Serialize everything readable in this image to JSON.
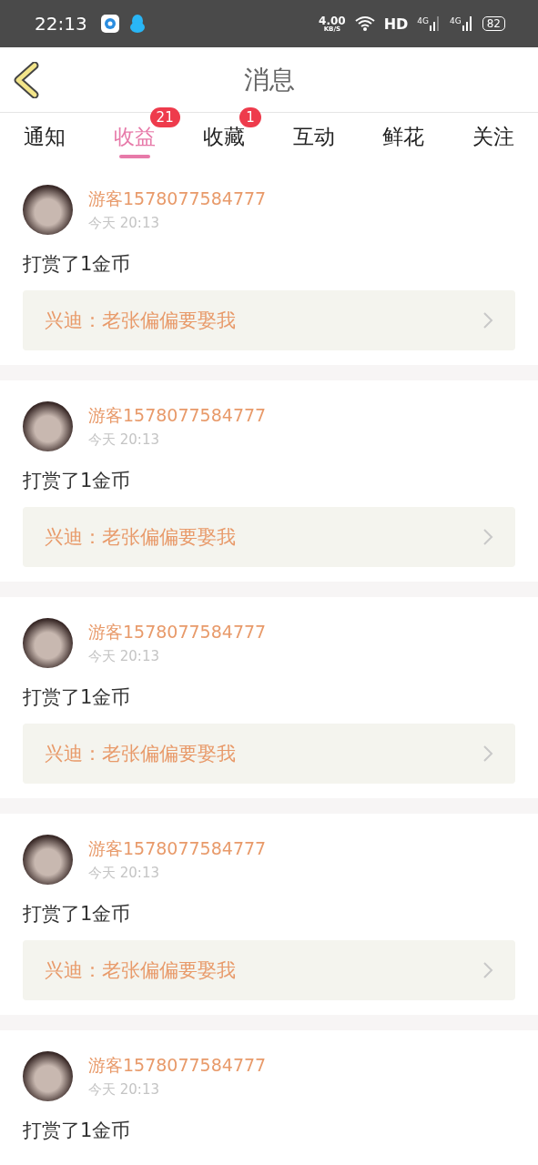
{
  "status_bar": {
    "time": "22:13",
    "speed_value": "4.00",
    "speed_unit": "KB/S",
    "hd": "HD",
    "network_1": "4G",
    "network_2": "4G",
    "battery": "82"
  },
  "header": {
    "title": "消息"
  },
  "tabs": [
    {
      "label": "通知",
      "selected": false
    },
    {
      "label": "收益",
      "selected": true,
      "badge": "21"
    },
    {
      "label": "收藏",
      "selected": false,
      "badge": "1"
    },
    {
      "label": "互动",
      "selected": false
    },
    {
      "label": "鲜花",
      "selected": false
    },
    {
      "label": "关注",
      "selected": false
    }
  ],
  "messages": [
    {
      "user": "游客1578077584777",
      "time": "今天 20:13",
      "text": "打赏了1金币",
      "link": "兴迪：老张偏偏要娶我"
    },
    {
      "user": "游客1578077584777",
      "time": "今天 20:13",
      "text": "打赏了1金币",
      "link": "兴迪：老张偏偏要娶我"
    },
    {
      "user": "游客1578077584777",
      "time": "今天 20:13",
      "text": "打赏了1金币",
      "link": "兴迪：老张偏偏要娶我"
    },
    {
      "user": "游客1578077584777",
      "time": "今天 20:13",
      "text": "打赏了1金币",
      "link": "兴迪：老张偏偏要娶我"
    },
    {
      "user": "游客1578077584777",
      "time": "今天 20:13",
      "text": "打赏了1金币"
    }
  ]
}
